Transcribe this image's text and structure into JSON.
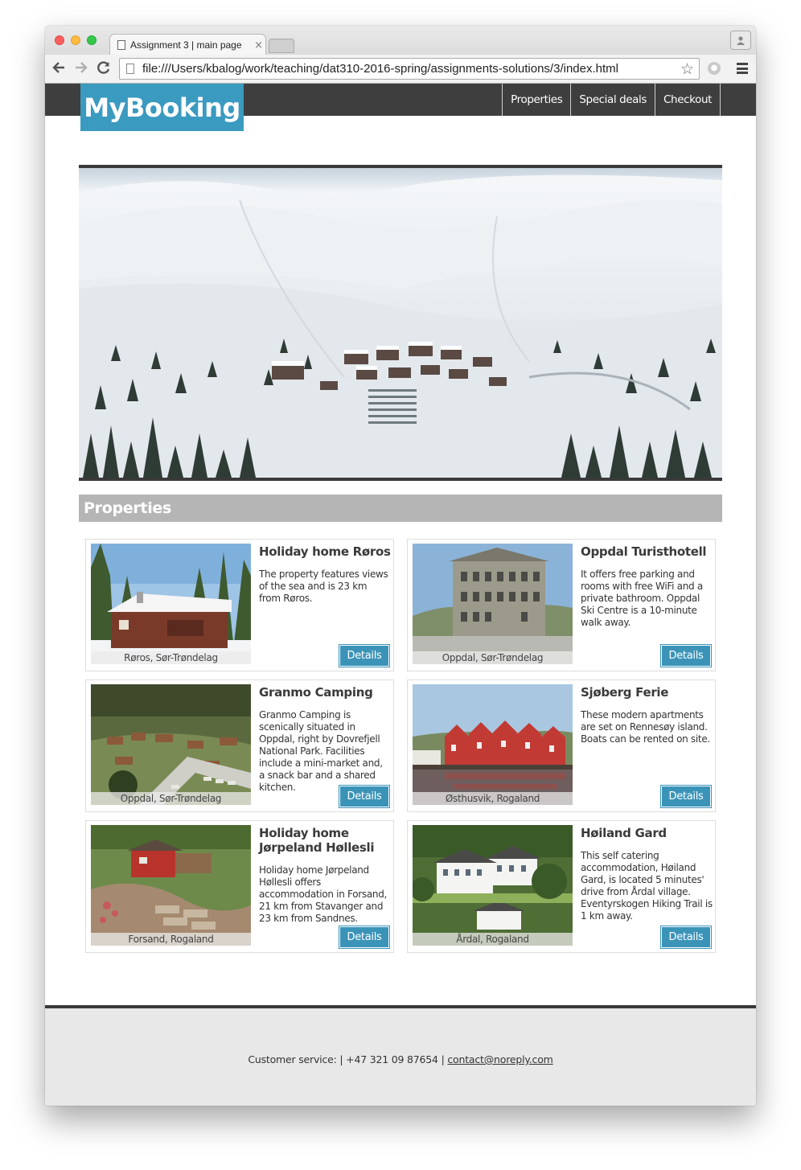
{
  "browser": {
    "tab_title": "Assignment 3 | main page",
    "tab_close": "×",
    "url": "file:///Users/kbalog/work/teaching/dat310-2016-spring/assignments-solutions/3/index.html",
    "icons": [
      "back-icon",
      "forward-icon",
      "reload-icon",
      "star-icon",
      "menu-icon",
      "profile-icon"
    ]
  },
  "site": {
    "logo": "MyBooking",
    "nav": [
      "Properties",
      "Special deals",
      "Checkout"
    ],
    "section_heading": "Properties",
    "details_label": "Details",
    "properties": [
      {
        "title": "Holiday home Røros",
        "description": "The property features views of the sea and is 23 km from Røros.",
        "location": "Røros, Sør-Trøndelag"
      },
      {
        "title": "Oppdal Turisthotell",
        "description": "It offers free parking and rooms with free WiFi and a private bathroom. Oppdal Ski Centre is a 10-minute walk away.",
        "location": "Oppdal, Sør-Trøndelag"
      },
      {
        "title": "Granmo Camping",
        "description": "Granmo Camping is scenically situated in Oppdal, right by Dovrefjell National Park. Facilities include a mini-market and, a snack bar and a shared kitchen.",
        "location": "Oppdal, Sør-Trøndelag"
      },
      {
        "title": "Sjøberg Ferie",
        "description": "These modern apartments are set on Rennesøy island. Boats can be rented on site.",
        "location": "Østhusvik, Rogaland"
      },
      {
        "title": "Holiday home Jørpeland Høllesli",
        "description": "Holiday home Jørpeland Høllesli offers accommodation in Forsand, 21 km from Stavanger and 23 km from Sandnes.",
        "location": "Forsand, Rogaland"
      },
      {
        "title": "Høiland Gard",
        "description": "This self catering accommodation, Høiland Gard, is located 5 minutes' drive from Årdal village. Eventyrskogen Hiking Trail is 1 km away.",
        "location": "Årdal, Rogaland"
      }
    ],
    "footer": {
      "prefix": "Customer service: | +47 321 09 87654 | ",
      "email": "contact@noreply.com"
    }
  },
  "colors": {
    "accent": "#3b9ac0",
    "header_bg": "#3e3e3e",
    "heading_bg": "#b5b5b5",
    "footer_bg": "#e8e8e8"
  }
}
